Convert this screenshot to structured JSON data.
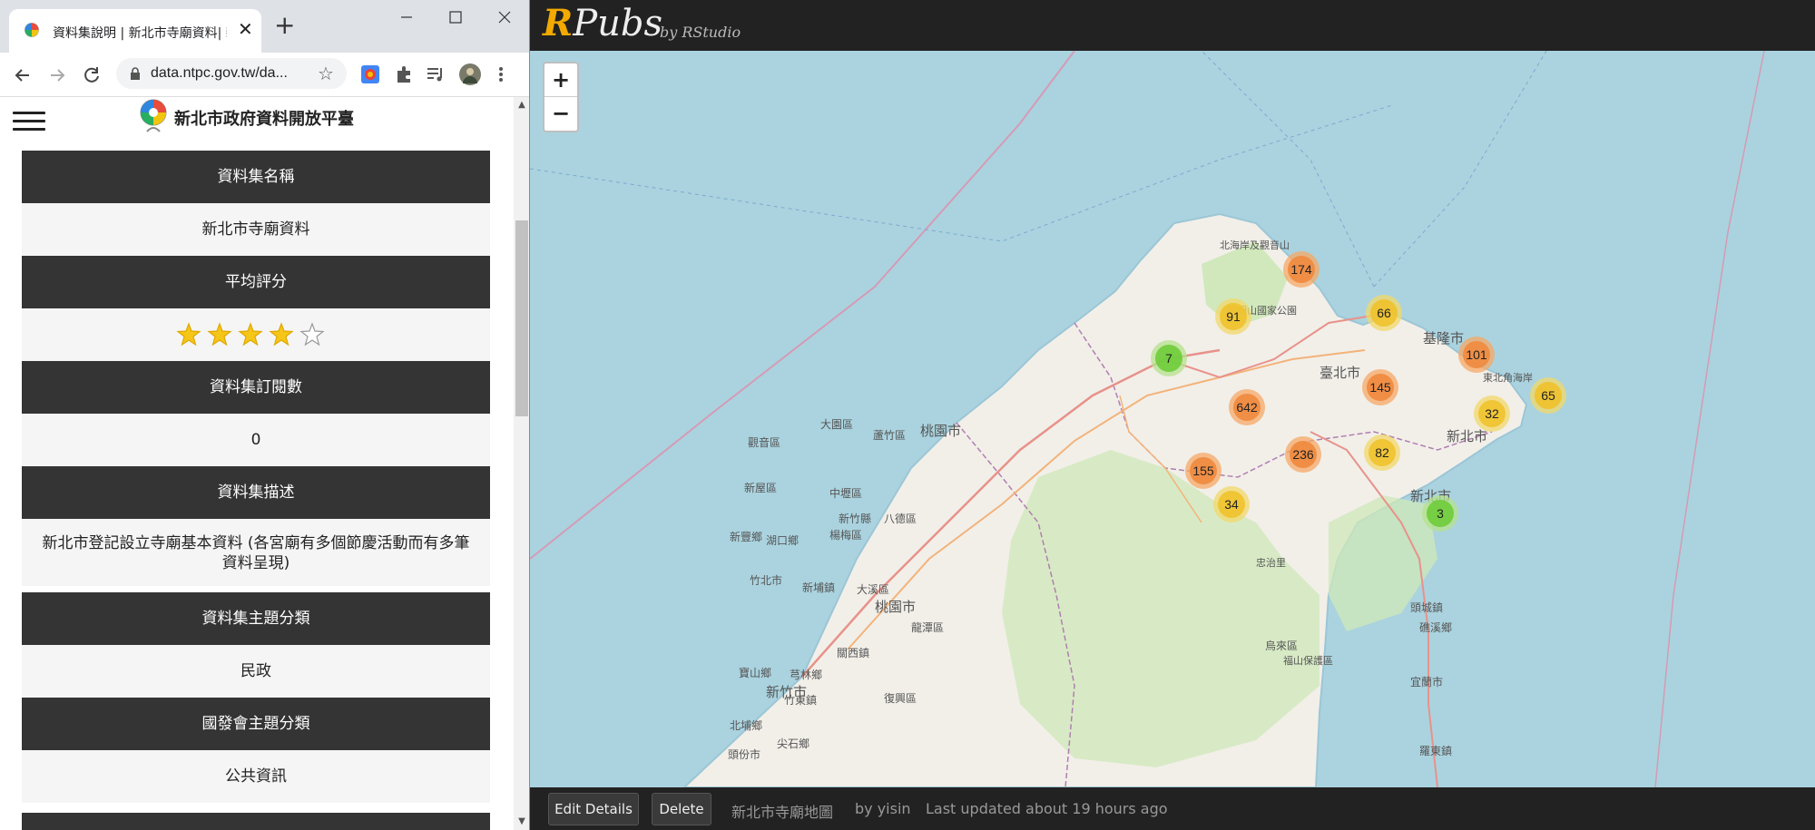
{
  "browser": {
    "tab_title": "資料集說明 | 新北市寺廟資料| 新",
    "url": "data.ntpc.gov.tw/da...",
    "buttons": {
      "new_tab": "+",
      "close_tab": "✕"
    }
  },
  "site": {
    "title": "新北市政府資料開放平臺"
  },
  "dataset": {
    "rows": [
      {
        "header": "資料集名稱",
        "value": "新北市寺廟資料"
      },
      {
        "header": "平均評分",
        "rating": 4,
        "rating_max": 5
      },
      {
        "header": "資料集訂閱數",
        "value": "0"
      },
      {
        "header": "資料集描述",
        "value": "新北市登記設立寺廟基本資料 (各宮廟有多個節慶活動而有多筆資料呈現)"
      },
      {
        "header": "資料集主題分類",
        "value": "民政"
      },
      {
        "header": "國發會主題分類",
        "value": "公共資訊"
      }
    ]
  },
  "rpubs": {
    "logo_r": "R",
    "logo_rest": "Pubs",
    "by": "by RStudio",
    "zoom_in": "+",
    "zoom_out": "−",
    "map_labels": [
      "臺北市",
      "新北市",
      "基隆市",
      "桃園市",
      "新竹市",
      "大園區",
      "蘆竹區",
      "觀音區",
      "新屋區",
      "中壢區",
      "八德區",
      "楊梅區",
      "湖口鄉",
      "新豐鄉",
      "竹北市",
      "新埔鎮",
      "大溪區",
      "桃園市",
      "龍潭區",
      "復興區",
      "關西鎮",
      "芎林鄉",
      "竹東鎮",
      "北埔鄉",
      "寶山鄉",
      "頭份市",
      "尖石鄉",
      "新北市",
      "烏來區",
      "宜蘭市",
      "頭城鎮",
      "礁溪鄉",
      "羅東鎮",
      "北海岸及觀音山",
      "陽明山國家公園",
      "東北角海岸",
      "新竹縣",
      "忠治里",
      "福山保護區"
    ],
    "clusters": [
      {
        "label": "174",
        "level": "orange"
      },
      {
        "label": "91",
        "level": "yellow"
      },
      {
        "label": "66",
        "level": "yellow"
      },
      {
        "label": "7",
        "level": "green"
      },
      {
        "label": "101",
        "level": "orange"
      },
      {
        "label": "642",
        "level": "orange"
      },
      {
        "label": "145",
        "level": "orange"
      },
      {
        "label": "65",
        "level": "yellow"
      },
      {
        "label": "32",
        "level": "yellow"
      },
      {
        "label": "236",
        "level": "orange"
      },
      {
        "label": "82",
        "level": "yellow"
      },
      {
        "label": "155",
        "level": "orange"
      },
      {
        "label": "34",
        "level": "yellow"
      },
      {
        "label": "3",
        "level": "green"
      }
    ],
    "cluster_colors": {
      "orange": {
        "outer": "#f5a866",
        "inner": "#f08a3e"
      },
      "yellow": {
        "outer": "#f2d86a",
        "inner": "#f0c22c"
      },
      "green": {
        "outer": "#b5e28c",
        "inner": "#6ecc39"
      }
    },
    "footer": {
      "edit_details": "Edit Details",
      "delete": "Delete",
      "title": "新北市寺廟地圖",
      "author": "by yisin",
      "updated": "Last updated about 19 hours ago"
    }
  }
}
